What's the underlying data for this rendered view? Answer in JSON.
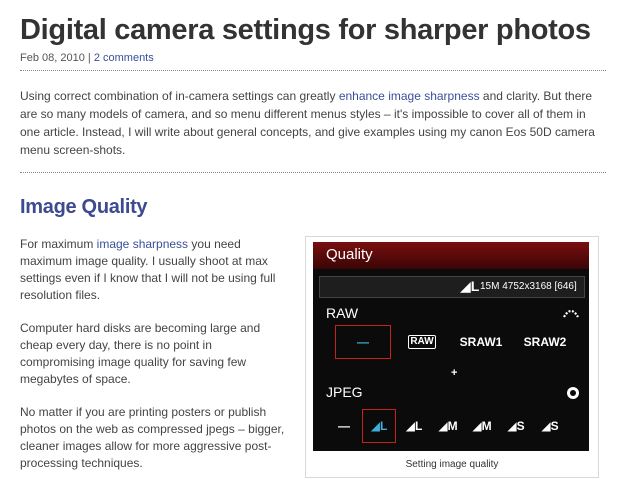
{
  "post": {
    "title": "Digital camera settings for sharper photos",
    "date": "Feb 08, 2010",
    "separator": " | ",
    "comments": "2 comments"
  },
  "intro": {
    "part1": "Using correct combination of in-camera settings can greatly ",
    "link": "enhance image sharpness",
    "part2": " and clarity. But there are so many models of camera, and so menu different menus styles – it's impossible to cover all of them in one article. Instead, I will write about general concepts, and give examples using my canon Eos 50D camera menu screen-shots."
  },
  "section": {
    "title": "Image Quality",
    "p1_a": "For maximum ",
    "p1_link": "image sharpness",
    "p1_b": " you need maximum image quality. I usually shoot at max settings even if I know that I will not be using full resolution files.",
    "p2": "Computer hard disks are becoming large and cheap every day, there is no point in compromising image quality for saving few megabytes of space.",
    "p3": "No matter if you are printing posters or publish photos on the web as compressed jpegs – bigger, cleaner images allow for more aggressive post-processing techniques."
  },
  "figure": {
    "caption": "Setting image quality",
    "screen": {
      "title": "Quality",
      "info_quality": "◢L",
      "info_text": "15M 4752x3168 [646]",
      "raw_label": "RAW",
      "jpeg_label": "JPEG",
      "plus": "+",
      "raw_options": [
        "—",
        "RAW",
        "SRAW1",
        "SRAW2"
      ],
      "jpeg_options": [
        "—",
        "◢L",
        "◢L",
        "◢M",
        "◢M",
        "◢S",
        "◢S"
      ],
      "raw_icon": "raw-wave-icon",
      "jpeg_icon": "jpeg-dial-icon",
      "accent_red": "#c81f1f",
      "selected_blue": "#3bb0d8"
    }
  }
}
